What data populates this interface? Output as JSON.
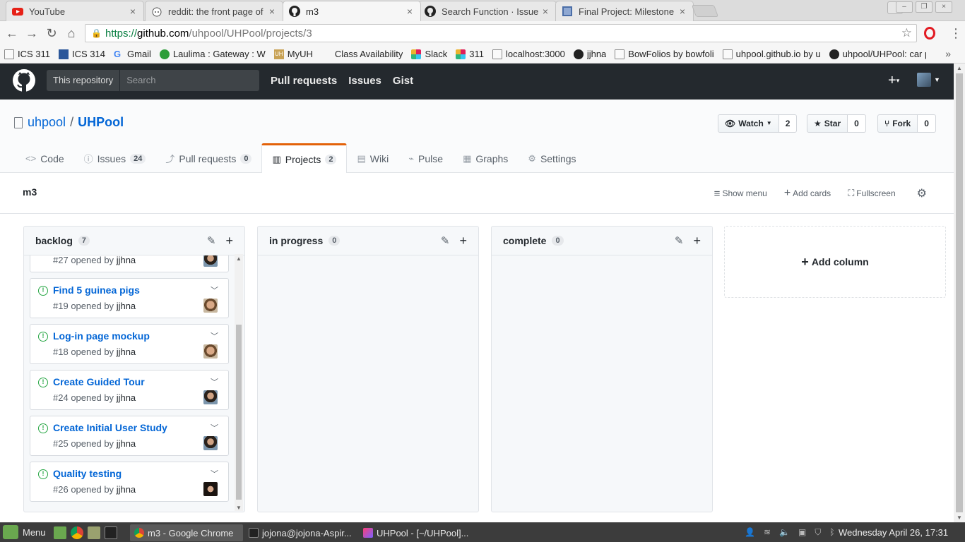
{
  "browser": {
    "tabs": [
      {
        "title": "YouTube",
        "icon": "youtube-icon"
      },
      {
        "title": "reddit: the front page of",
        "icon": "reddit-icon"
      },
      {
        "title": "m3",
        "icon": "github-icon"
      },
      {
        "title": "Search Function · Issue",
        "icon": "github-icon"
      },
      {
        "title": "Final Project: Milestone",
        "icon": "doc-icon"
      }
    ],
    "active_tab": 2,
    "url": {
      "scheme": "https://",
      "host": "github.com",
      "path": "/uhpool/UHPool/projects/3"
    },
    "bookmarks": [
      {
        "label": "ICS 311",
        "icon": "page-icon"
      },
      {
        "label": "ICS 314",
        "icon": "blue-square-icon"
      },
      {
        "label": "Gmail",
        "icon": "google-icon"
      },
      {
        "label": "Laulima : Gateway : W",
        "icon": "leaf-icon"
      },
      {
        "label": "MyUH",
        "icon": "uh-icon"
      },
      {
        "label": "Class Availability",
        "icon": "none"
      },
      {
        "label": "Slack",
        "icon": "slack-icon"
      },
      {
        "label": "311",
        "icon": "slack-icon"
      },
      {
        "label": "localhost:3000",
        "icon": "page-icon"
      },
      {
        "label": "jjhna",
        "icon": "github-icon"
      },
      {
        "label": "BowFolios by bowfoli",
        "icon": "page-icon"
      },
      {
        "label": "uhpool.github.io by u",
        "icon": "page-icon"
      },
      {
        "label": "uhpool/UHPool: car p",
        "icon": "github-icon"
      }
    ]
  },
  "github": {
    "scope_label": "This repository",
    "search_placeholder": "Search",
    "nav": [
      "Pull requests",
      "Issues",
      "Gist"
    ],
    "owner": "uhpool",
    "repo": "UHPool",
    "watch": {
      "label": "Watch",
      "count": "2"
    },
    "star": {
      "label": "Star",
      "count": "0"
    },
    "fork": {
      "label": "Fork",
      "count": "0"
    },
    "reponav": [
      {
        "label": "Code",
        "icon": "code-icon",
        "count": ""
      },
      {
        "label": "Issues",
        "icon": "issue-icon",
        "count": "24"
      },
      {
        "label": "Pull requests",
        "icon": "pr-icon",
        "count": "0"
      },
      {
        "label": "Projects",
        "icon": "project-icon",
        "count": "2"
      },
      {
        "label": "Wiki",
        "icon": "book-icon",
        "count": ""
      },
      {
        "label": "Pulse",
        "icon": "pulse-icon",
        "count": ""
      },
      {
        "label": "Graphs",
        "icon": "graph-icon",
        "count": ""
      },
      {
        "label": "Settings",
        "icon": "gear-icon",
        "count": ""
      }
    ],
    "selected_tab": "Projects"
  },
  "project": {
    "name": "m3",
    "actions": {
      "show_menu": "Show menu",
      "add_cards": "Add cards",
      "fullscreen": "Fullscreen"
    },
    "columns": [
      {
        "name": "backlog",
        "count": "7",
        "cards": [
          {
            "title": "",
            "number": "#27",
            "opened_by": "opened by",
            "user": "jjhna",
            "avatar": "av3"
          },
          {
            "title": "Find 5 guinea pigs",
            "number": "#19",
            "opened_by": "opened by",
            "user": "jjhna",
            "avatar": "av2"
          },
          {
            "title": "Log-in page mockup",
            "number": "#18",
            "opened_by": "opened by",
            "user": "jjhna",
            "avatar": "av2"
          },
          {
            "title": "Create Guided Tour",
            "number": "#24",
            "opened_by": "opened by",
            "user": "jjhna",
            "avatar": "av3"
          },
          {
            "title": "Create Initial User Study",
            "number": "#25",
            "opened_by": "opened by",
            "user": "jjhna",
            "avatar": "av3"
          },
          {
            "title": "Quality testing",
            "number": "#26",
            "opened_by": "opened by",
            "user": "jjhna",
            "avatar": "av4"
          }
        ]
      },
      {
        "name": "in progress",
        "count": "0",
        "cards": []
      },
      {
        "name": "complete",
        "count": "0",
        "cards": []
      }
    ],
    "add_column": "Add column"
  },
  "taskbar": {
    "menu": "Menu",
    "tasks": [
      {
        "label": "m3 - Google Chrome",
        "active": true
      },
      {
        "label": "jojona@jojona-Aspir...",
        "active": false
      },
      {
        "label": "UHPool - [~/UHPool]...",
        "active": false
      }
    ],
    "clock": "Wednesday April 26, 17:31"
  },
  "colors": {
    "accent": "#0366d6",
    "selected_tab_border": "#e36209",
    "issue_open": "#28a745",
    "header_bg": "#24292e"
  }
}
